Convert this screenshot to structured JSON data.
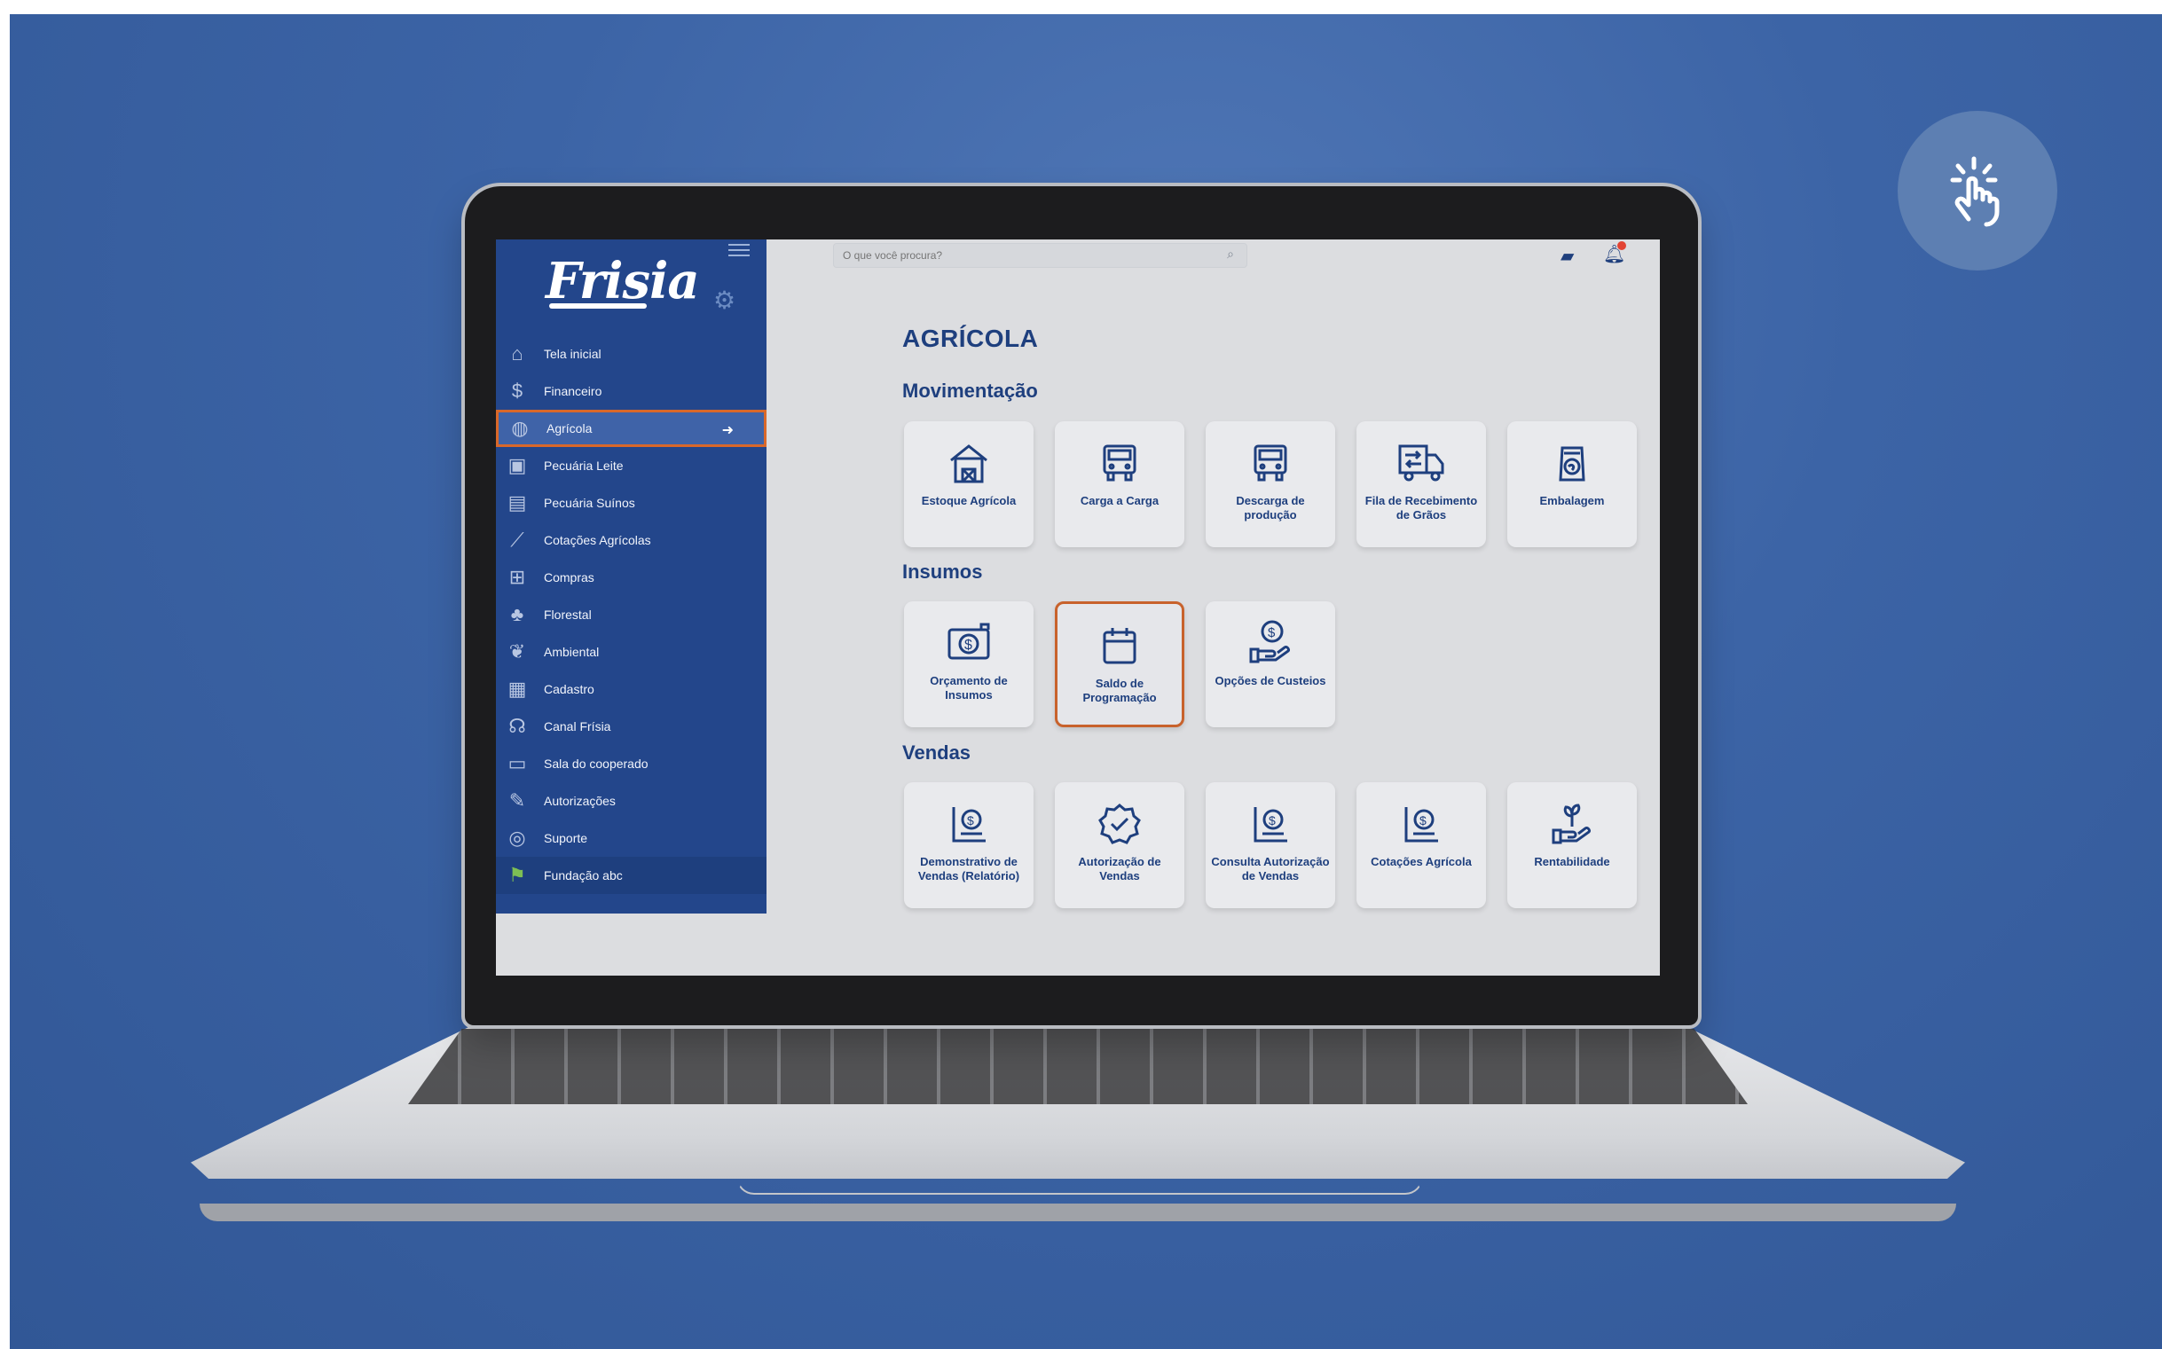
{
  "app": {
    "brand": "Frisia",
    "search_placeholder": "O que você procura?"
  },
  "sidebar": {
    "items": [
      {
        "label": "Tela inicial",
        "icon": "home-icon"
      },
      {
        "label": "Financeiro",
        "icon": "dollar-circle-icon"
      },
      {
        "label": "Agrícola",
        "icon": "globe-icon",
        "active": true
      },
      {
        "label": "Pecuária Leite",
        "icon": "milk-icon"
      },
      {
        "label": "Pecuária Suínos",
        "icon": "pig-icon"
      },
      {
        "label": "Cotações Agrícolas",
        "icon": "chart-icon"
      },
      {
        "label": "Compras",
        "icon": "cart-icon"
      },
      {
        "label": "Florestal",
        "icon": "tree-icon"
      },
      {
        "label": "Ambiental",
        "icon": "leaf-icon"
      },
      {
        "label": "Cadastro",
        "icon": "document-icon"
      },
      {
        "label": "Canal Frísia",
        "icon": "broadcast-icon"
      },
      {
        "label": "Sala do cooperado",
        "icon": "folder-icon"
      },
      {
        "label": "Autorizações",
        "icon": "pen-icon"
      },
      {
        "label": "Suporte",
        "icon": "headset-icon"
      },
      {
        "label": "Fundação abc",
        "icon": "flag-icon"
      }
    ]
  },
  "main": {
    "title": "AGRÍCOLA",
    "sections": [
      {
        "title": "Movimentação",
        "cards": [
          "Estoque Agrícola",
          "Carga a Carga",
          "Descarga de produção",
          "Fila de Recebimento de Grãos",
          "Embalagem"
        ]
      },
      {
        "title": "Insumos",
        "cards": [
          "Orçamento de Insumos",
          "Saldo de Programação",
          "Opções de Custeios"
        ]
      },
      {
        "title": "Vendas",
        "cards": [
          "Demonstrativo de Vendas (Relatório)",
          "Autorização de Vendas",
          "Consulta Autorização de Vendas",
          "Cotações Agrícola",
          "Rentabilidade"
        ]
      }
    ],
    "selected_card": "Saldo de Programação"
  },
  "colors": {
    "background": "#3c64a6",
    "sidebar": "#23468b",
    "accent_border": "#d9682a",
    "heading": "#1e3f7e"
  }
}
